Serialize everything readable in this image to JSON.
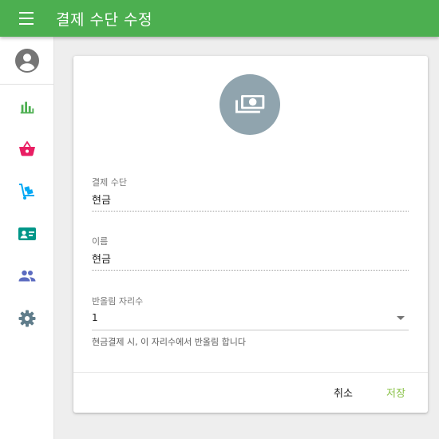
{
  "appbar": {
    "title": "결제 수단 수정",
    "color": "#4caf50",
    "menu_icon": "menu-icon"
  },
  "sidebar": {
    "avatar_icon": "account-circle-icon",
    "items": [
      {
        "icon": "bar-chart-icon",
        "color": "#4caf50"
      },
      {
        "icon": "shopping-basket-icon",
        "color": "#e91e63"
      },
      {
        "icon": "dolly-cart-icon",
        "color": "#03a9f4"
      },
      {
        "icon": "contact-card-icon",
        "color": "#009688"
      },
      {
        "icon": "people-icon",
        "color": "#5c6bc0"
      },
      {
        "icon": "settings-icon",
        "color": "#607d8b"
      }
    ]
  },
  "card": {
    "avatar_icon": "money-icon",
    "avatar_color": "#90a4ae",
    "fields": {
      "payment_method": {
        "label": "결제 수단",
        "value": "현금"
      },
      "name": {
        "label": "이름",
        "value": "현금"
      },
      "rounding": {
        "label": "반올림 자리수",
        "value": "1",
        "helper": "현금결제 시, 이 자리수에서 반올림 합니다"
      }
    },
    "actions": {
      "cancel_label": "취소",
      "save_label": "저장",
      "save_color": "#8bc34a"
    }
  }
}
